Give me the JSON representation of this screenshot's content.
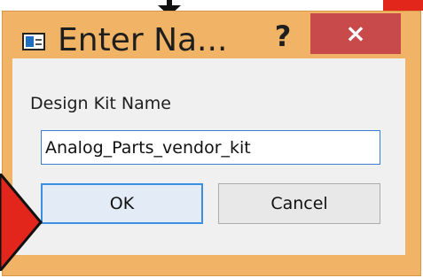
{
  "window": {
    "title": "Enter Na...",
    "help_label": "?",
    "close_label": "×",
    "icon": "dialog-window-icon"
  },
  "form": {
    "label": "Design Kit Name",
    "input_value": "Analog_Parts_vendor_kit"
  },
  "buttons": {
    "ok_label": "OK",
    "cancel_label": "Cancel"
  },
  "annotations": {
    "top_arrow": "down-arrow-icon",
    "left_arrow": "right-arrow-icon",
    "left_arrow_color": "#e2261c"
  },
  "colors": {
    "frame": "#f1b467",
    "close_button": "#c84a4a",
    "focus_border": "#3c8fe0"
  }
}
